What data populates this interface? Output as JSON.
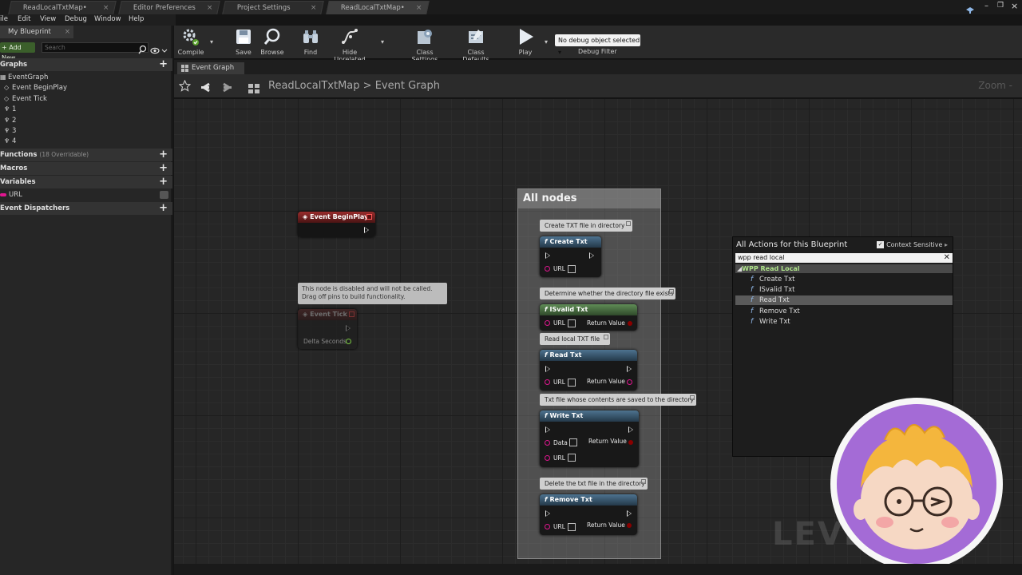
{
  "doc_tabs": [
    {
      "label": "ReadLocalTxtMap•",
      "active": false
    },
    {
      "label": "Editor Preferences",
      "active": false
    },
    {
      "label": "Project Settings",
      "active": false
    },
    {
      "label": "ReadLocalTxtMap•",
      "active": true
    }
  ],
  "menu": [
    "ile",
    "Edit",
    "View",
    "Debug",
    "Window",
    "Help"
  ],
  "left_panel": {
    "tab_label": "My Blueprint",
    "add_new_label": "+ Add New",
    "search_placeholder": "Search",
    "sections": {
      "graphs": "Graphs",
      "functions": "Functions",
      "functions_sub": "(18 Overridable)",
      "macros": "Macros",
      "variables": "Variables",
      "dispatchers": "Event Dispatchers"
    },
    "graph_items": [
      "EventGraph",
      "Event BeginPlay",
      "Event Tick",
      "1",
      "2",
      "3",
      "4"
    ],
    "variable_items": [
      "URL"
    ]
  },
  "toolbar": {
    "compile": "Compile",
    "save": "Save",
    "browse": "Browse",
    "find": "Find",
    "hide_unrelated": "Hide Unrelated",
    "class_settings": "Class Settings",
    "class_defaults": "Class Defaults",
    "play": "Play",
    "debug_select": "No debug object selected ▾",
    "debug_filter": "Debug Filter"
  },
  "graph_tab": "Event Graph",
  "breadcrumb": {
    "root": "ReadLocalTxtMap",
    "sep": ">",
    "leaf": "Event Graph"
  },
  "zoom_label": "Zoom -",
  "nodes": {
    "begin_play": "Event BeginPlay",
    "disabled_note_line1": "This node is disabled and will not be called.",
    "disabled_note_line2": "Drag off pins to build functionality.",
    "event_tick": "Event Tick",
    "delta_seconds": "Delta Seconds",
    "comment_title": "All nodes",
    "create_comment": "Create TXT file in directory",
    "create_txt": "Create Txt",
    "isvalid_comment": "Determine whether the directory file exists",
    "isvalid_txt": "ISvalid Txt",
    "read_comment": "Read local TXT file",
    "read_txt": "Read Txt",
    "write_comment": "Txt file whose contents are saved to the directory",
    "write_txt": "Write Txt",
    "remove_comment": "Delete the txt file in the directory",
    "remove_txt": "Remove Txt",
    "url": "URL",
    "data": "Data",
    "return_value": "Return Value"
  },
  "actions_menu": {
    "title": "All Actions for this Blueprint",
    "context_sensitive": "Context Sensitive",
    "search_value": "wpp read local",
    "category": "WPP Read Local",
    "items": [
      "Create Txt",
      "ISvalid Txt",
      "Read Txt",
      "Remove Txt",
      "Write Txt"
    ],
    "selected_item": "Read Txt"
  },
  "watermark": "LEVEL          T"
}
